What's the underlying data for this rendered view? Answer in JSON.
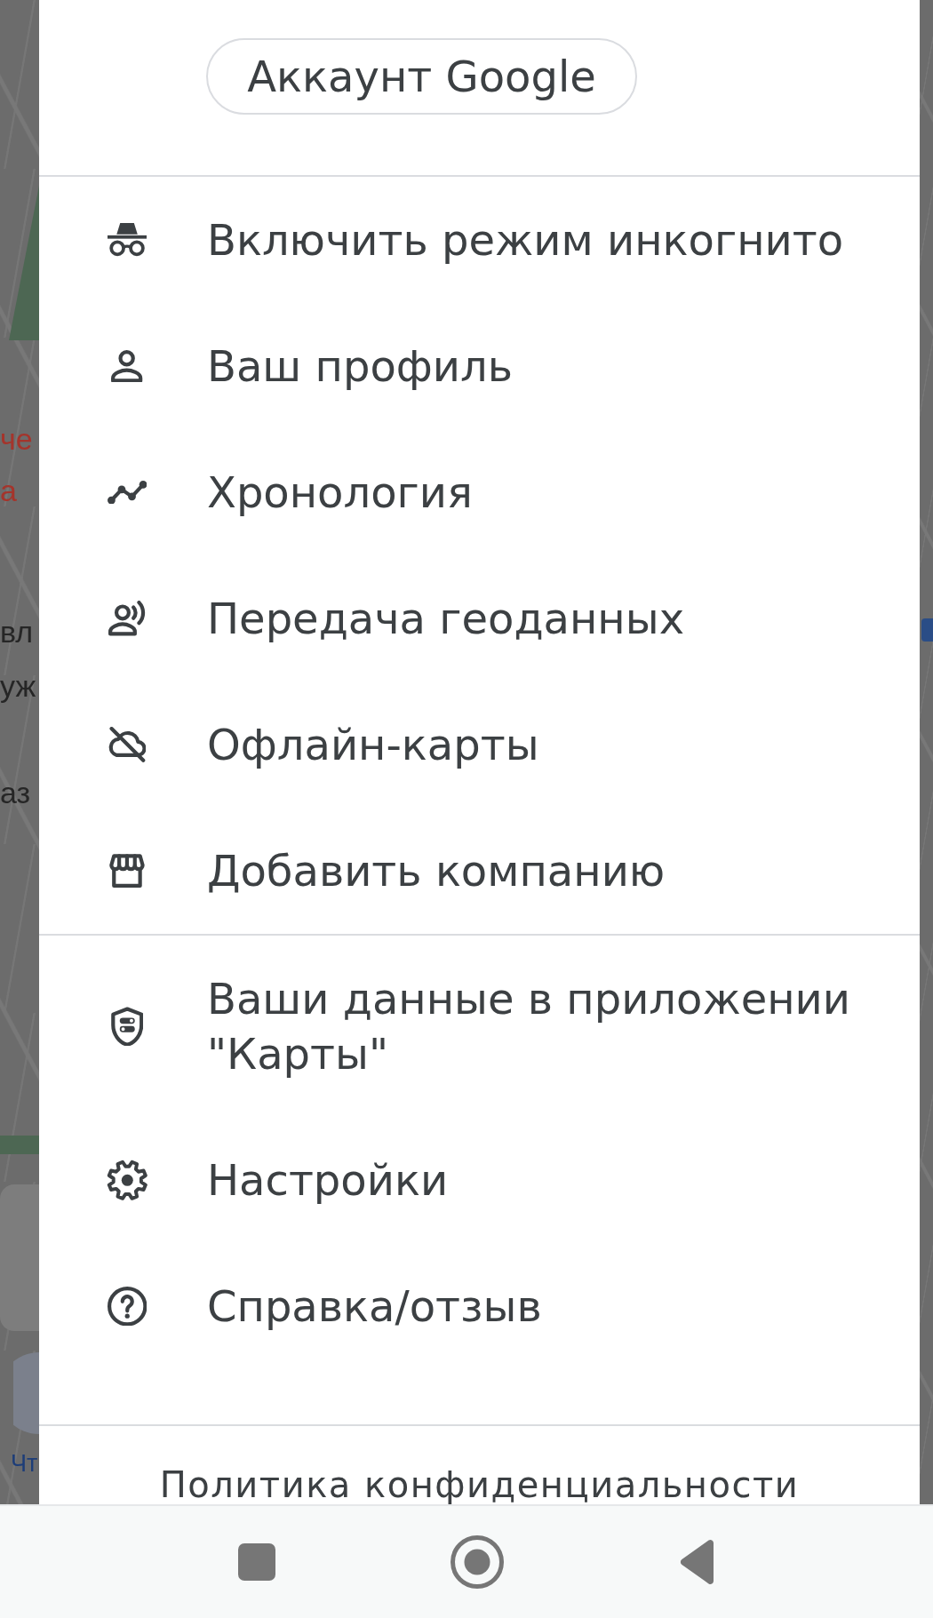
{
  "map_backdrop": {
    "labels": [
      {
        "text": "че",
        "color": "#a5342b"
      },
      {
        "text": "а",
        "color": "#a5342b"
      },
      {
        "text": "вл",
        "color": "#262626"
      },
      {
        "text": "уж",
        "color": "#262626"
      },
      {
        "text": "аз",
        "color": "#262626"
      },
      {
        "text": "Чт",
        "color": "#1d3d78"
      }
    ]
  },
  "account_button": {
    "label": "Аккаунт Google"
  },
  "menu_sections": [
    {
      "items": [
        {
          "label": "Включить режим инкогнито"
        },
        {
          "label": "Ваш профиль"
        },
        {
          "label": "Хронология"
        },
        {
          "label": "Передача геоданных"
        },
        {
          "label": "Офлайн-карты"
        },
        {
          "label": "Добавить компанию"
        }
      ]
    },
    {
      "items": [
        {
          "label": "Ваши данные в приложении \"Карты\""
        },
        {
          "label": "Настройки"
        },
        {
          "label": "Справка/отзыв"
        }
      ]
    }
  ],
  "footer": {
    "link": "Политика конфиденциальности"
  }
}
